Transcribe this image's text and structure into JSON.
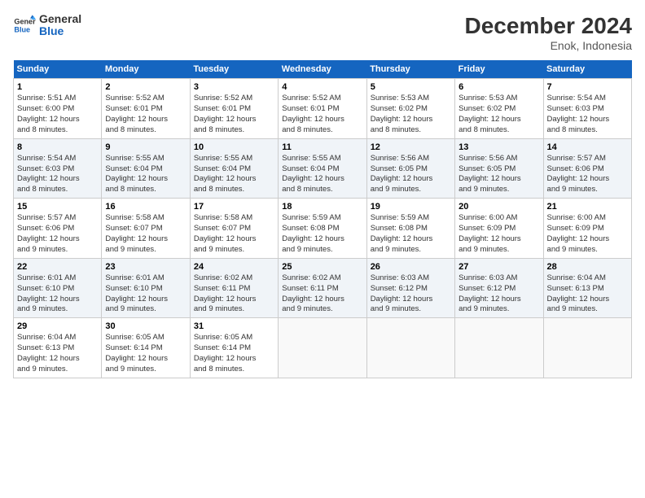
{
  "logo": {
    "line1": "General",
    "line2": "Blue"
  },
  "title": "December 2024",
  "subtitle": "Enok, Indonesia",
  "headers": [
    "Sunday",
    "Monday",
    "Tuesday",
    "Wednesday",
    "Thursday",
    "Friday",
    "Saturday"
  ],
  "weeks": [
    [
      {
        "day": "1",
        "info": "Sunrise: 5:51 AM\nSunset: 6:00 PM\nDaylight: 12 hours\nand 8 minutes."
      },
      {
        "day": "2",
        "info": "Sunrise: 5:52 AM\nSunset: 6:01 PM\nDaylight: 12 hours\nand 8 minutes."
      },
      {
        "day": "3",
        "info": "Sunrise: 5:52 AM\nSunset: 6:01 PM\nDaylight: 12 hours\nand 8 minutes."
      },
      {
        "day": "4",
        "info": "Sunrise: 5:52 AM\nSunset: 6:01 PM\nDaylight: 12 hours\nand 8 minutes."
      },
      {
        "day": "5",
        "info": "Sunrise: 5:53 AM\nSunset: 6:02 PM\nDaylight: 12 hours\nand 8 minutes."
      },
      {
        "day": "6",
        "info": "Sunrise: 5:53 AM\nSunset: 6:02 PM\nDaylight: 12 hours\nand 8 minutes."
      },
      {
        "day": "7",
        "info": "Sunrise: 5:54 AM\nSunset: 6:03 PM\nDaylight: 12 hours\nand 8 minutes."
      }
    ],
    [
      {
        "day": "8",
        "info": "Sunrise: 5:54 AM\nSunset: 6:03 PM\nDaylight: 12 hours\nand 8 minutes."
      },
      {
        "day": "9",
        "info": "Sunrise: 5:55 AM\nSunset: 6:04 PM\nDaylight: 12 hours\nand 8 minutes."
      },
      {
        "day": "10",
        "info": "Sunrise: 5:55 AM\nSunset: 6:04 PM\nDaylight: 12 hours\nand 8 minutes."
      },
      {
        "day": "11",
        "info": "Sunrise: 5:55 AM\nSunset: 6:04 PM\nDaylight: 12 hours\nand 8 minutes."
      },
      {
        "day": "12",
        "info": "Sunrise: 5:56 AM\nSunset: 6:05 PM\nDaylight: 12 hours\nand 9 minutes."
      },
      {
        "day": "13",
        "info": "Sunrise: 5:56 AM\nSunset: 6:05 PM\nDaylight: 12 hours\nand 9 minutes."
      },
      {
        "day": "14",
        "info": "Sunrise: 5:57 AM\nSunset: 6:06 PM\nDaylight: 12 hours\nand 9 minutes."
      }
    ],
    [
      {
        "day": "15",
        "info": "Sunrise: 5:57 AM\nSunset: 6:06 PM\nDaylight: 12 hours\nand 9 minutes."
      },
      {
        "day": "16",
        "info": "Sunrise: 5:58 AM\nSunset: 6:07 PM\nDaylight: 12 hours\nand 9 minutes."
      },
      {
        "day": "17",
        "info": "Sunrise: 5:58 AM\nSunset: 6:07 PM\nDaylight: 12 hours\nand 9 minutes."
      },
      {
        "day": "18",
        "info": "Sunrise: 5:59 AM\nSunset: 6:08 PM\nDaylight: 12 hours\nand 9 minutes."
      },
      {
        "day": "19",
        "info": "Sunrise: 5:59 AM\nSunset: 6:08 PM\nDaylight: 12 hours\nand 9 minutes."
      },
      {
        "day": "20",
        "info": "Sunrise: 6:00 AM\nSunset: 6:09 PM\nDaylight: 12 hours\nand 9 minutes."
      },
      {
        "day": "21",
        "info": "Sunrise: 6:00 AM\nSunset: 6:09 PM\nDaylight: 12 hours\nand 9 minutes."
      }
    ],
    [
      {
        "day": "22",
        "info": "Sunrise: 6:01 AM\nSunset: 6:10 PM\nDaylight: 12 hours\nand 9 minutes."
      },
      {
        "day": "23",
        "info": "Sunrise: 6:01 AM\nSunset: 6:10 PM\nDaylight: 12 hours\nand 9 minutes."
      },
      {
        "day": "24",
        "info": "Sunrise: 6:02 AM\nSunset: 6:11 PM\nDaylight: 12 hours\nand 9 minutes."
      },
      {
        "day": "25",
        "info": "Sunrise: 6:02 AM\nSunset: 6:11 PM\nDaylight: 12 hours\nand 9 minutes."
      },
      {
        "day": "26",
        "info": "Sunrise: 6:03 AM\nSunset: 6:12 PM\nDaylight: 12 hours\nand 9 minutes."
      },
      {
        "day": "27",
        "info": "Sunrise: 6:03 AM\nSunset: 6:12 PM\nDaylight: 12 hours\nand 9 minutes."
      },
      {
        "day": "28",
        "info": "Sunrise: 6:04 AM\nSunset: 6:13 PM\nDaylight: 12 hours\nand 9 minutes."
      }
    ],
    [
      {
        "day": "29",
        "info": "Sunrise: 6:04 AM\nSunset: 6:13 PM\nDaylight: 12 hours\nand 9 minutes."
      },
      {
        "day": "30",
        "info": "Sunrise: 6:05 AM\nSunset: 6:14 PM\nDaylight: 12 hours\nand 9 minutes."
      },
      {
        "day": "31",
        "info": "Sunrise: 6:05 AM\nSunset: 6:14 PM\nDaylight: 12 hours\nand 8 minutes."
      },
      {
        "day": "",
        "info": ""
      },
      {
        "day": "",
        "info": ""
      },
      {
        "day": "",
        "info": ""
      },
      {
        "day": "",
        "info": ""
      }
    ]
  ]
}
